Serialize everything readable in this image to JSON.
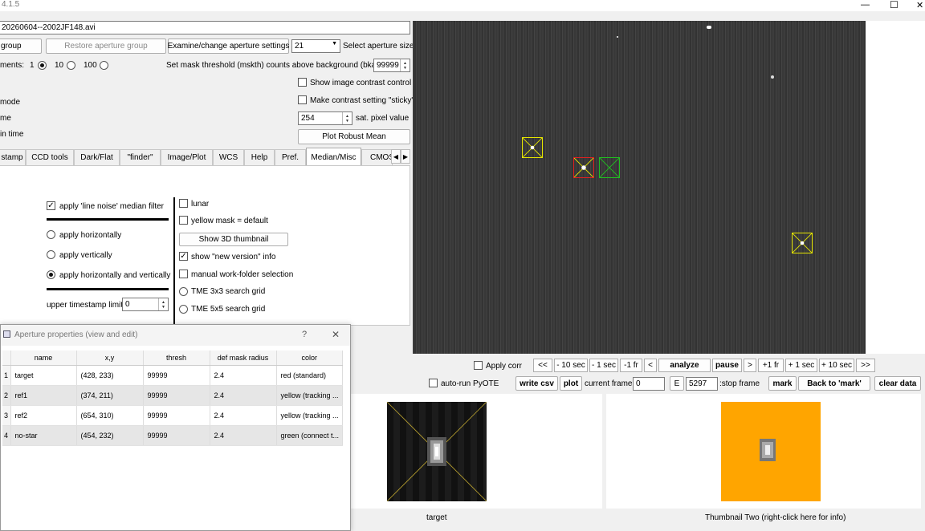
{
  "title_bar": {
    "version": "4.1.5",
    "minimize": "—",
    "maximize": "☐",
    "close": "✕"
  },
  "file_path": "20260604--2002JF148.avi",
  "top": {
    "set_group_btn": "group",
    "restore_btn": "Restore aperture group",
    "examine_btn": "Examine/change aperture settings",
    "aperture_size_value": "21",
    "aperture_size_label": "Select aperture size",
    "increments_label": "ments:",
    "radio_1": "1",
    "radio_10": "10",
    "radio_100": "100",
    "mask_threshold_label": "Set mask threshold (mskth) counts above background (bkavg)",
    "mask_threshold_value": "99999",
    "contrast_control": "Show image contrast control",
    "contrast_sticky": "Make contrast setting \"sticky\"",
    "sat_value": "254",
    "sat_label": "sat. pixel value",
    "plot_robust": "Plot Robust Mean",
    "left_mode": "mode",
    "left_me": "me",
    "left_in_time": "in time"
  },
  "tabs": [
    "stamp",
    "CCD tools",
    "Dark/Flat",
    "\"finder\"",
    "Image/Plot",
    "WCS",
    "Help",
    "Pref.",
    "Median/Misc",
    "CMOS"
  ],
  "median": {
    "apply_line_noise": "apply 'line noise' median filter",
    "horiz": "apply horizontally",
    "vert": "apply vertically",
    "both": "apply horizontally and vertically",
    "upper_ts": "upper timestamp limit",
    "upper_ts_value": "0"
  },
  "misc": {
    "lunar": "lunar",
    "yellow_mask": "yellow mask = default",
    "show_3d": "Show 3D thumbnail",
    "new_version": "show \"new version\" info",
    "manual_wf": "manual work-folder selection",
    "tme3": "TME 3x3 search grid",
    "tme5": "TME 5x5 search grid"
  },
  "dialog": {
    "title": "Aperture properties (view and edit)",
    "help": "?",
    "close": "✕",
    "columns": [
      "name",
      "x,y",
      "thresh",
      "def mask radius",
      "color"
    ],
    "rows": [
      {
        "n": "1",
        "name": "target",
        "xy": "(428, 233)",
        "thresh": "99999",
        "radius": "2.4",
        "color": "red (standard)"
      },
      {
        "n": "2",
        "name": "ref1",
        "xy": "(374, 211)",
        "thresh": "99999",
        "radius": "2.4",
        "color": "yellow (tracking ..."
      },
      {
        "n": "3",
        "name": "ref2",
        "xy": "(654, 310)",
        "thresh": "99999",
        "radius": "2.4",
        "color": "yellow (tracking ..."
      },
      {
        "n": "4",
        "name": "no-star",
        "xy": "(454, 232)",
        "thresh": "99999",
        "radius": "2.4",
        "color": "green (connect t..."
      }
    ]
  },
  "playback": {
    "apply_corr": "Apply corr",
    "b_first": "<<",
    "b_m10": "- 10 sec",
    "b_m1": "- 1 sec",
    "b_mfr": "-1 fr",
    "b_back": "<",
    "analyze": "analyze",
    "pause": "pause",
    "b_fwd": ">",
    "b_pfr": "+1 fr",
    "b_p1": "+ 1 sec",
    "b_p10": "+ 10 sec",
    "b_last": ">>",
    "auto_pyote": "auto-run PyOTE",
    "write_csv": "write csv",
    "plot": "plot",
    "current_frame_label": "current frame:",
    "current_frame": "0",
    "e": "E",
    "stop_frame": "5297",
    "stop_label": ":stop frame",
    "mark": "mark",
    "back_to_mark": "Back to 'mark'",
    "clear_data": "clear data"
  },
  "thumbs": {
    "one_label": "target",
    "two_label": "Thumbnail Two (right-click here for info)"
  },
  "colors": {
    "target_box": "#e02020",
    "ref_box": "#e6e600",
    "nostar_box": "#20c020",
    "orange": "#ffa500",
    "image_bg": "#3a3a3a"
  }
}
